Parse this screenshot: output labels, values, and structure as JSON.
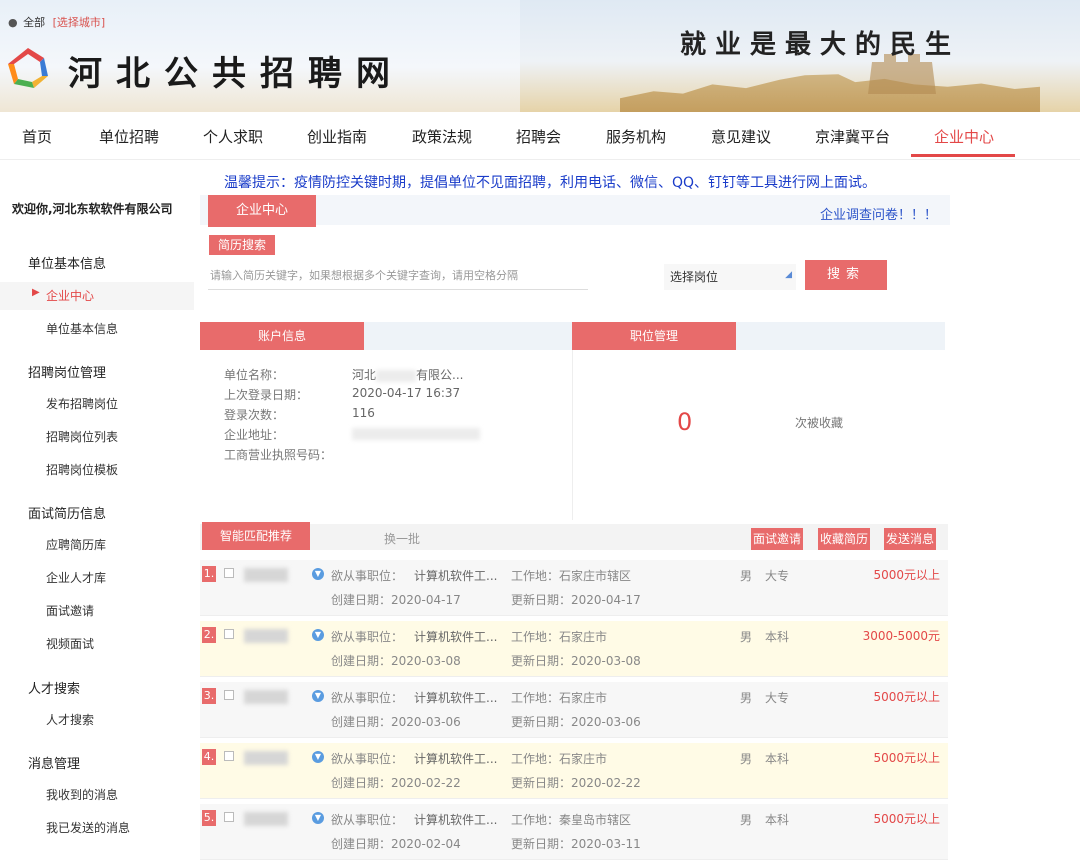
{
  "header": {
    "location_all": "全部",
    "location_select": "[选择城市]",
    "site_title": "河北公共招聘网",
    "slogan": "就业是最大的民生"
  },
  "nav": [
    {
      "label": "首页"
    },
    {
      "label": "单位招聘"
    },
    {
      "label": "个人求职"
    },
    {
      "label": "创业指南"
    },
    {
      "label": "政策法规"
    },
    {
      "label": "招聘会"
    },
    {
      "label": "服务机构"
    },
    {
      "label": "意见建议"
    },
    {
      "label": "京津冀平台"
    },
    {
      "label": "企业中心",
      "active": true
    }
  ],
  "notice": "温馨提示：疫情防控关键时期，提倡单位不见面招聘，利用电话、微信、QQ、钉钉等工具进行网上面试。",
  "sidebar": {
    "welcome": "欢迎你,河北东软软件有限公司",
    "groups": [
      {
        "title": "单位基本信息",
        "items": [
          "企业中心",
          "单位基本信息"
        ]
      },
      {
        "title": "招聘岗位管理",
        "items": [
          "发布招聘岗位",
          "招聘岗位列表",
          "招聘岗位模板"
        ]
      },
      {
        "title": "面试简历信息",
        "items": [
          "应聘简历库",
          "企业人才库",
          "面试邀请",
          "视频面试"
        ]
      },
      {
        "title": "人才搜索",
        "items": [
          "人才搜索"
        ]
      },
      {
        "title": "消息管理",
        "items": [
          "我收到的消息",
          "我已发送的消息"
        ]
      }
    ]
  },
  "main": {
    "tab": "企业中心",
    "survey": "企业调查问卷！！！",
    "resume_search_label": "简历搜索",
    "search_placeholder": "请输入简历关键字，如果想根据多个关键字查询，请用空格分隔",
    "post_select": "选择岗位",
    "search_btn": "搜索"
  },
  "account": {
    "title": "账户信息",
    "rows": [
      {
        "label": "单位名称：",
        "value": "河北",
        "value2": "有限公..."
      },
      {
        "label": "上次登录日期：",
        "value": "2020-04-17 16:37"
      },
      {
        "label": "登录次数：",
        "value": "116"
      },
      {
        "label": "企业地址：",
        "value": ""
      },
      {
        "label": "工商营业执照号码：",
        "value": ""
      }
    ]
  },
  "positions": {
    "title": "职位管理",
    "count": "0",
    "count_label": "次被收藏"
  },
  "recommend": {
    "title": "智能匹配推荐",
    "swap": "换一批",
    "actions": [
      "面试邀请",
      "收藏简历",
      "发送消息"
    ],
    "rows": [
      {
        "num": "1.",
        "intent_label": "欲从事职位：",
        "intent": "计算机软件工...",
        "location": "工作地：石家庄市辖区",
        "gender": "男",
        "edu": "大专",
        "salary": "5000元以上",
        "created": "创建日期：2020-04-17",
        "updated": "更新日期：2020-04-17"
      },
      {
        "num": "2.",
        "intent_label": "欲从事职位：",
        "intent": "计算机软件工...",
        "location": "工作地：石家庄市",
        "gender": "男",
        "edu": "本科",
        "salary": "3000-5000元",
        "created": "创建日期：2020-03-08",
        "updated": "更新日期：2020-03-08"
      },
      {
        "num": "3.",
        "intent_label": "欲从事职位：",
        "intent": "计算机软件工...",
        "location": "工作地：石家庄市",
        "gender": "男",
        "edu": "大专",
        "salary": "5000元以上",
        "created": "创建日期：2020-03-06",
        "updated": "更新日期：2020-03-06"
      },
      {
        "num": "4.",
        "intent_label": "欲从事职位：",
        "intent": "计算机软件工...",
        "location": "工作地：石家庄市",
        "gender": "男",
        "edu": "本科",
        "salary": "5000元以上",
        "created": "创建日期：2020-02-22",
        "updated": "更新日期：2020-02-22"
      },
      {
        "num": "5.",
        "intent_label": "欲从事职位：",
        "intent": "计算机软件工...",
        "location": "工作地：秦皇岛市辖区",
        "gender": "男",
        "edu": "本科",
        "salary": "5000元以上",
        "created": "创建日期：2020-02-04",
        "updated": "更新日期：2020-03-11"
      }
    ]
  },
  "colors": {
    "accent": "#e86b6b",
    "link": "#1a3cc9",
    "active": "#e34848"
  }
}
